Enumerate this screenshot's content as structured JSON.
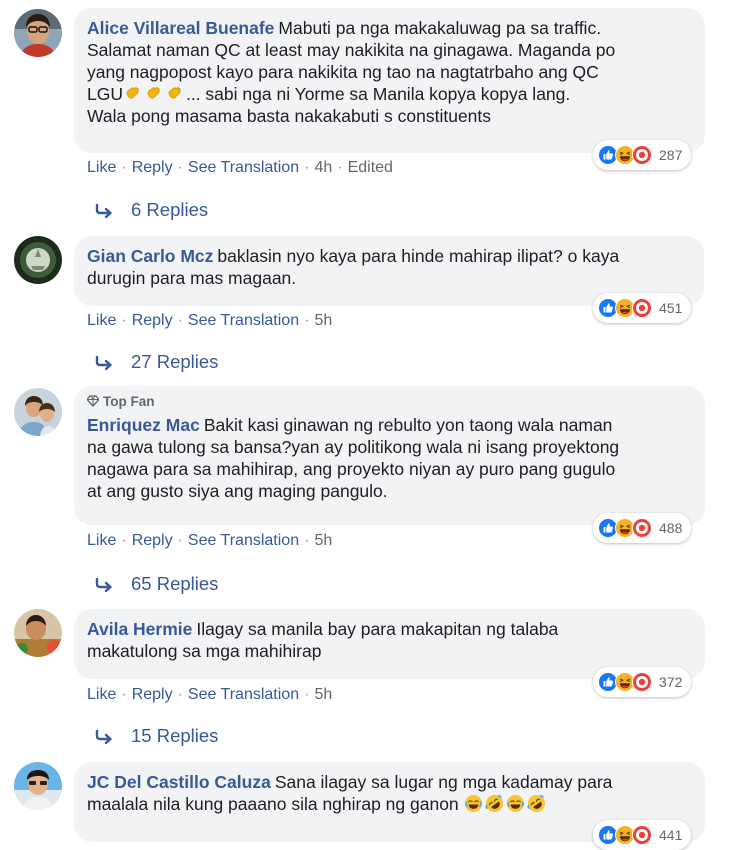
{
  "actions": {
    "like": "Like",
    "reply": "Reply",
    "see_translation": "See Translation",
    "separator": "·"
  },
  "colors": {
    "name_link": "#385898",
    "bubble_bg": "#f2f3f5",
    "meta_gray": "#606770",
    "like_blue": "#1877f2",
    "haha_yellow": "#f7b125",
    "angry_red": "#e9413c"
  },
  "comments": [
    {
      "author": "Alice Villareal Buenafe",
      "text_lines": [
        "Mabuti pa nga makakaluwag pa sa traffic.",
        "Salamat naman QC at least may nakikita na ginagawa. Maganda po",
        "yang nagpopost kayo para nakikita ng tao na nagtatrbaho ang QC"
      ],
      "text_line4_prefix": "LGU",
      "text_line4_emojis": [
        "clap",
        "clap",
        "clap"
      ],
      "text_line4_suffix": "... sabi nga ni Yorme sa Manila kopya kopya lang.",
      "text_line5": "Wala pong masama basta nakakabuti s constituents",
      "time": "4h",
      "edited": "Edited",
      "reactions": [
        "like",
        "haha",
        "angry"
      ],
      "reaction_count": "287",
      "replies": "6 Replies"
    },
    {
      "author": "Gian Carlo Mcz",
      "text_lines": [
        "baklasin nyo kaya para hinde mahirap ilipat? o kaya",
        "durugin para mas magaan."
      ],
      "time": "5h",
      "reactions": [
        "like",
        "haha",
        "angry"
      ],
      "reaction_count": "451",
      "replies": "27 Replies"
    },
    {
      "badge": "Top Fan",
      "author": "Enriquez Mac",
      "text_lines": [
        "Bakit kasi ginawan ng rebulto yon taong wala naman",
        "na gawa tulong sa bansa?yan ay politikong wala ni isang proyektong",
        "nagawa para sa mahihirap, ang proyekto niyan ay puro pang gugulo",
        "at ang gusto siya ang maging pangulo."
      ],
      "time": "5h",
      "reactions": [
        "like",
        "haha",
        "angry"
      ],
      "reaction_count": "488",
      "replies": "65 Replies"
    },
    {
      "author": "Avila Hermie",
      "text_lines": [
        "Ilagay sa manila bay para makapitan ng talaba",
        "makatulong sa mga mahihirap"
      ],
      "time": "5h",
      "reactions": [
        "like",
        "haha",
        "angry"
      ],
      "reaction_count": "372",
      "replies": "15 Replies"
    },
    {
      "author": "JC Del Castillo Caluza",
      "text_lines": [
        "Sana ilagay sa lugar ng mga kadamay para",
        "maalala nila kung paaano sila nghirap ng ganon"
      ],
      "text_emojis": [
        "joy",
        "rofl",
        "joy",
        "rofl"
      ],
      "reactions": [
        "like",
        "haha",
        "angry"
      ],
      "reaction_count": "441"
    }
  ]
}
